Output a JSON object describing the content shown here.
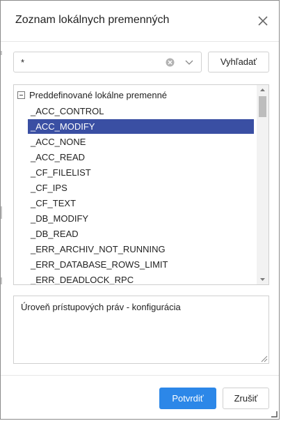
{
  "dialog": {
    "title": "Zoznam lokálnych premenných",
    "close_icon": "close-icon"
  },
  "search": {
    "value": "*",
    "clear_icon": "clear-circle-icon",
    "dropdown_icon": "chevron-down-icon",
    "button_label": "Vyhľadať"
  },
  "tree": {
    "root_label": "Preddefinované lokálne premenné",
    "expanded": true,
    "selected_index": 1,
    "items": [
      "_ACC_CONTROL",
      "_ACC_MODIFY",
      "_ACC_NONE",
      "_ACC_READ",
      "_CF_FILELIST",
      "_CF_IPS",
      "_CF_TEXT",
      "_DB_MODIFY",
      "_DB_READ",
      "_ERR_ARCHIV_NOT_RUNNING",
      "_ERR_DATABASE_ROWS_LIMIT",
      "_ERR_DEADLOCK_RPC"
    ]
  },
  "description": "Úroveň prístupových práv - konfigurácia",
  "footer": {
    "ok_label": "Potvrdiť",
    "cancel_label": "Zrušiť"
  },
  "colors": {
    "selection": "#3a4fa3",
    "primary_button": "#2c87e8"
  }
}
